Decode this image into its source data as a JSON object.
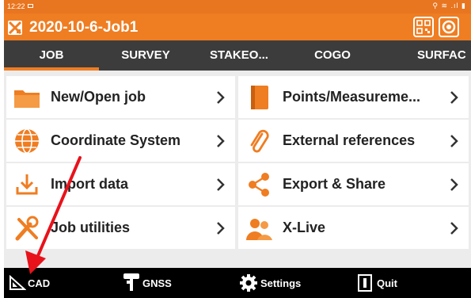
{
  "status": {
    "time": "12:22",
    "right": "⚲ ≋ .ıl ▮"
  },
  "title": "2020-10-6-Job1",
  "tabs": [
    {
      "label": "JOB",
      "active": true
    },
    {
      "label": "SURVEY",
      "active": false
    },
    {
      "label": "STAKEO...",
      "active": false
    },
    {
      "label": "COGO",
      "active": false
    },
    {
      "label": "SURFAC",
      "active": false
    }
  ],
  "menu": [
    {
      "label": "New/Open job",
      "icon": "folder-icon"
    },
    {
      "label": "Points/Measureme...",
      "icon": "notebook-icon"
    },
    {
      "label": "Coordinate System",
      "icon": "globe-icon"
    },
    {
      "label": "External references",
      "icon": "paperclip-icon"
    },
    {
      "label": "Import data",
      "icon": "download-icon"
    },
    {
      "label": "Export & Share",
      "icon": "share-icon"
    },
    {
      "label": "Job utilities",
      "icon": "tools-icon"
    },
    {
      "label": "X-Live",
      "icon": "users-icon"
    }
  ],
  "bottom": {
    "cad": "CAD",
    "gnss": "GNSS",
    "settings": "Settings",
    "quit": "Quit"
  },
  "colors": {
    "accent": "#ef7d22",
    "tabbar": "#3c3c3c",
    "annotation": "#e8121b"
  }
}
